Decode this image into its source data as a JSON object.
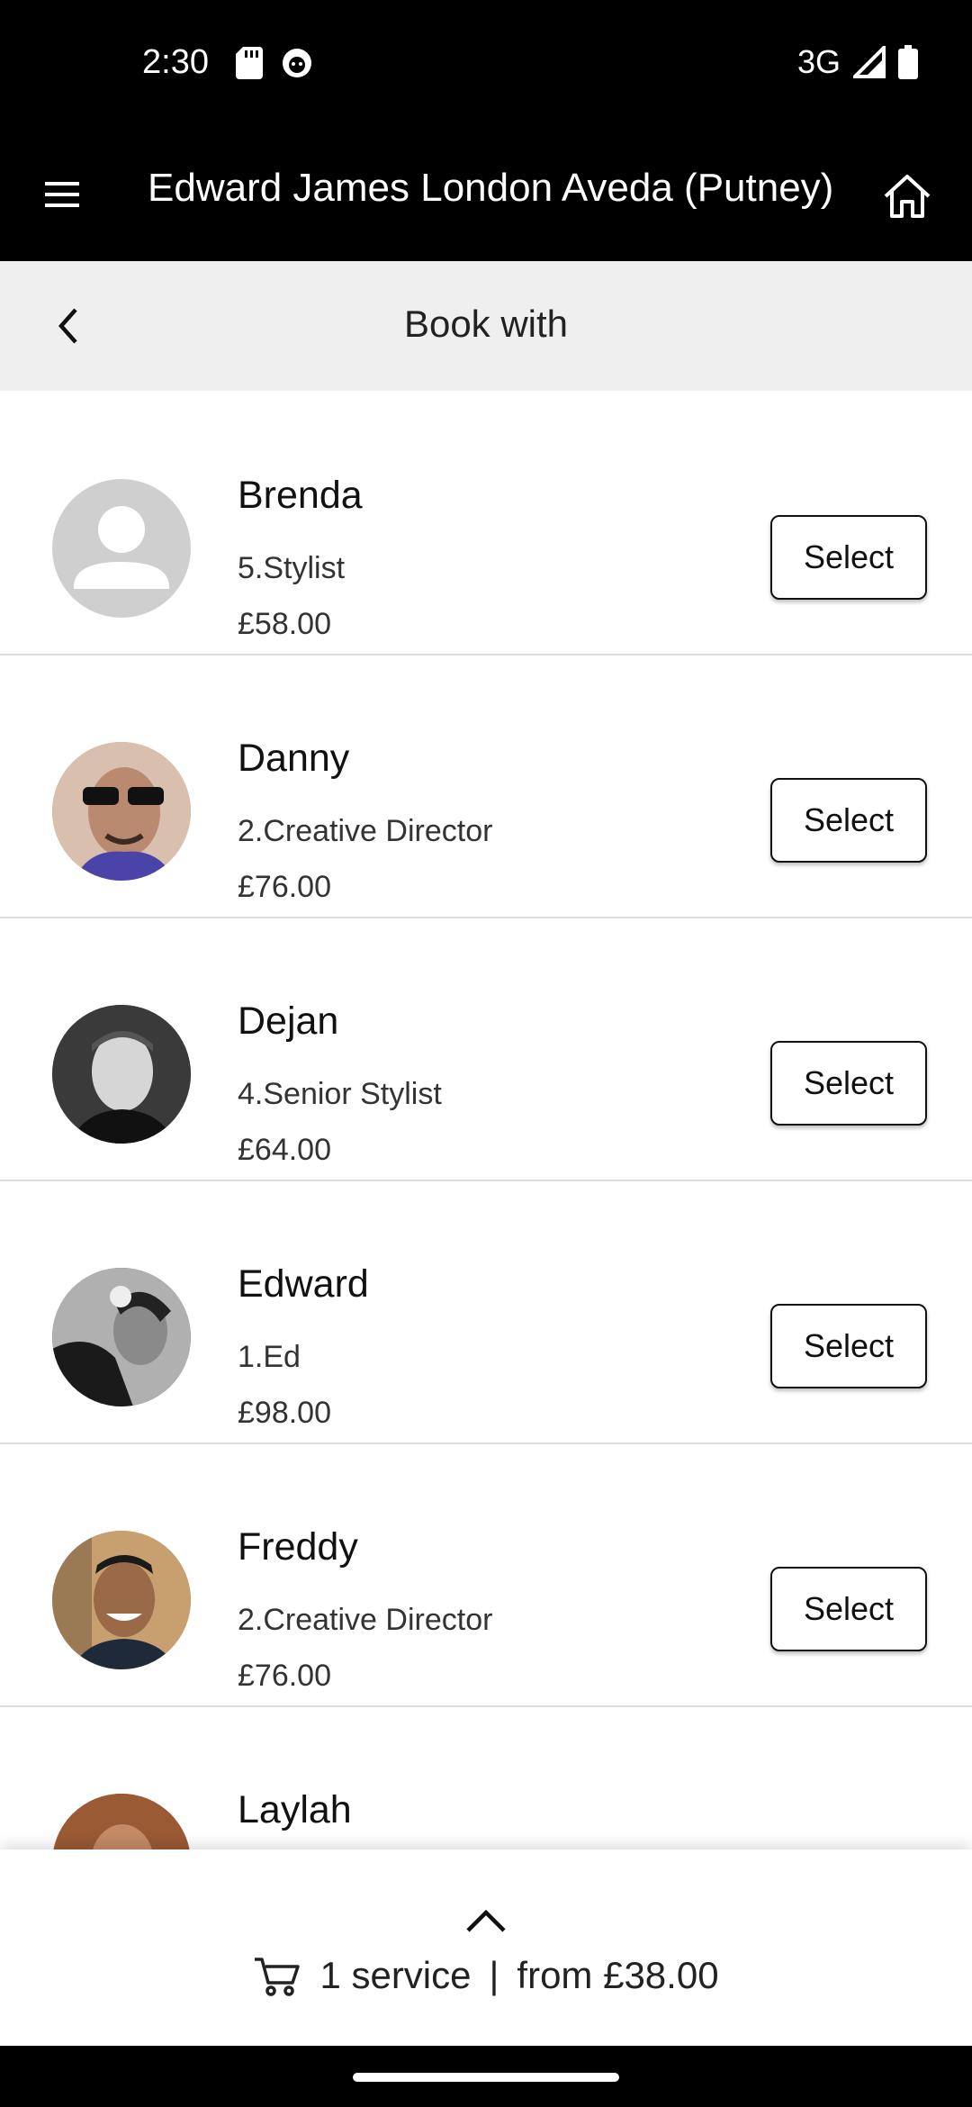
{
  "status_bar": {
    "time": "2:30",
    "network": "3G",
    "icons": [
      "sd-card-icon",
      "notification-face-icon",
      "signal-icon",
      "battery-icon"
    ]
  },
  "app_bar": {
    "title": "Edward James London Aveda (Putney)",
    "icons": [
      "menu-icon",
      "home-icon"
    ]
  },
  "sub_header": {
    "title": "Book with",
    "icons": [
      "back-chevron-icon"
    ]
  },
  "stylists": [
    {
      "name": "Brenda",
      "role": "5.Stylist",
      "price": "£58.00",
      "action": "Select",
      "avatar": "placeholder"
    },
    {
      "name": "Danny",
      "role": "2.Creative Director",
      "price": "£76.00",
      "action": "Select",
      "avatar": "photo"
    },
    {
      "name": "Dejan",
      "role": "4.Senior Stylist",
      "price": "£64.00",
      "action": "Select",
      "avatar": "photo"
    },
    {
      "name": "Edward",
      "role": "1.Ed",
      "price": "£98.00",
      "action": "Select",
      "avatar": "photo"
    },
    {
      "name": "Freddy",
      "role": "2.Creative Director",
      "price": "£76.00",
      "action": "Select",
      "avatar": "photo"
    },
    {
      "name": "Laylah",
      "role": "",
      "price": "",
      "action": "",
      "avatar": "photo"
    }
  ],
  "cart": {
    "summary": "1 service",
    "separator": "|",
    "total": "from £38.00",
    "icons": [
      "chevron-up-icon",
      "cart-icon"
    ]
  },
  "colors": {
    "bars": "#000000",
    "sub_header_bg": "#efefef",
    "divider": "#dcdcdc"
  }
}
